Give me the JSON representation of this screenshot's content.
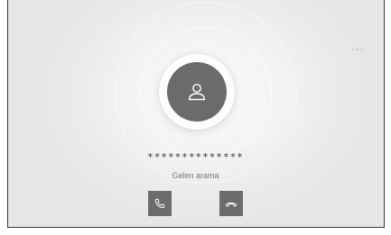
{
  "caller": {
    "number": "**************",
    "status": "Gelen arama"
  },
  "icons": {
    "avatar": "person-icon",
    "answer": "phone-icon",
    "decline": "hang-up-icon",
    "more": "more-dots-icon"
  },
  "colors": {
    "button_background": "#6c6c6c",
    "avatar_background": "#6b6b6b",
    "screen_background": "#ececec"
  }
}
